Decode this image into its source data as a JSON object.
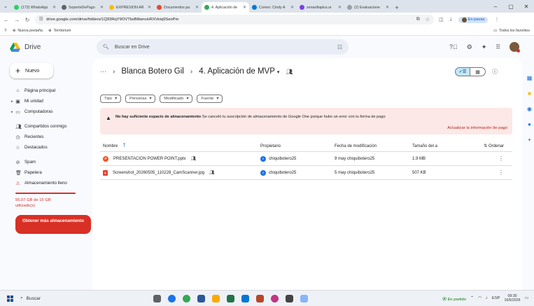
{
  "browser": {
    "tabs": [
      {
        "label": "(173) WhatsApp",
        "color": "#25d366",
        "active": false
      },
      {
        "label": "SoporteDePago",
        "color": "#5f6368",
        "active": false
      },
      {
        "label": "EXPRESIÓN AR",
        "color": "#fbbc04",
        "active": false
      },
      {
        "label": "Documentos pa",
        "color": "#ea4335",
        "active": false
      },
      {
        "label": "4. Aplicación de",
        "color": "#34a853",
        "active": true
      },
      {
        "label": "Correo: Cindy A",
        "color": "#0078d4",
        "active": false
      },
      {
        "label": "zenaofiaplus.ur",
        "color": "#7b3fe4",
        "active": false
      },
      {
        "label": "(2) Evaluacione",
        "color": "#9aa0a6",
        "active": false
      }
    ],
    "url": "drive.google.com/drive/folders/1Q93RqY9OVTbxB8wnoivRXVeiq9SeoPm",
    "pause_label": "En pausa",
    "bookmarks": {
      "new_tab": "Nueva pestaña",
      "territorium": "Territorium",
      "all_favorites": "Todos los favoritos"
    }
  },
  "drive": {
    "app_name": "Drive",
    "search_placeholder": "Buscar en Drive",
    "new_label": "Nuevo",
    "nav": [
      {
        "label": "Página principal",
        "icon": "home-icon"
      },
      {
        "label": "Mi unidad",
        "icon": "my-drive-icon"
      },
      {
        "label": "Computadoras",
        "icon": "computers-icon"
      },
      {
        "label": "Compartidos conmigo",
        "icon": "shared-icon"
      },
      {
        "label": "Recientes",
        "icon": "recent-icon"
      },
      {
        "label": "Destacados",
        "icon": "star-icon"
      },
      {
        "label": "Spam",
        "icon": "spam-icon"
      },
      {
        "label": "Papelera",
        "icon": "trash-icon"
      },
      {
        "label": "Almacenamiento lleno",
        "icon": "warning-icon"
      }
    ],
    "storage_text": "56,07 GB de 15 GB utilizado(s)",
    "get_storage_label": "Obtener más almacenamiento",
    "breadcrumb": {
      "parent": "Blanca Botero Gil",
      "current": "4. Aplicación de MVP"
    },
    "filters": [
      "Tipo",
      "Personas",
      "Modificado",
      "Fuente"
    ],
    "banner": {
      "bold": "No hay suficiente espacio de almacenamiento",
      "text": "Se canceló tu suscripción de almacenamiento de Google One porque hubo un error con tu forma de pago",
      "action": "Actualizar la información de pago"
    },
    "table": {
      "headers": {
        "name": "Nombre",
        "owner": "Propietario",
        "modified": "Fecha de modificación",
        "size": "Tamaño del a",
        "sort": "Ordenar"
      },
      "rows": [
        {
          "name": "PRESENTACION POWER POINT.pptx",
          "owner": "chiquibotero25",
          "modified": "9 may chiquibotero25",
          "size": "1.9 MB"
        },
        {
          "name": "Screenshot_20260505_110228_CamScanner.jpg",
          "owner": "chiquibotero25",
          "modified": "5 may chiquibotero25",
          "size": "507 KB"
        }
      ]
    }
  },
  "taskbar": {
    "search_label": "Buscar",
    "weather": "En partido",
    "lang": "ESP",
    "time": "09:30",
    "date": "16/5/2026"
  }
}
